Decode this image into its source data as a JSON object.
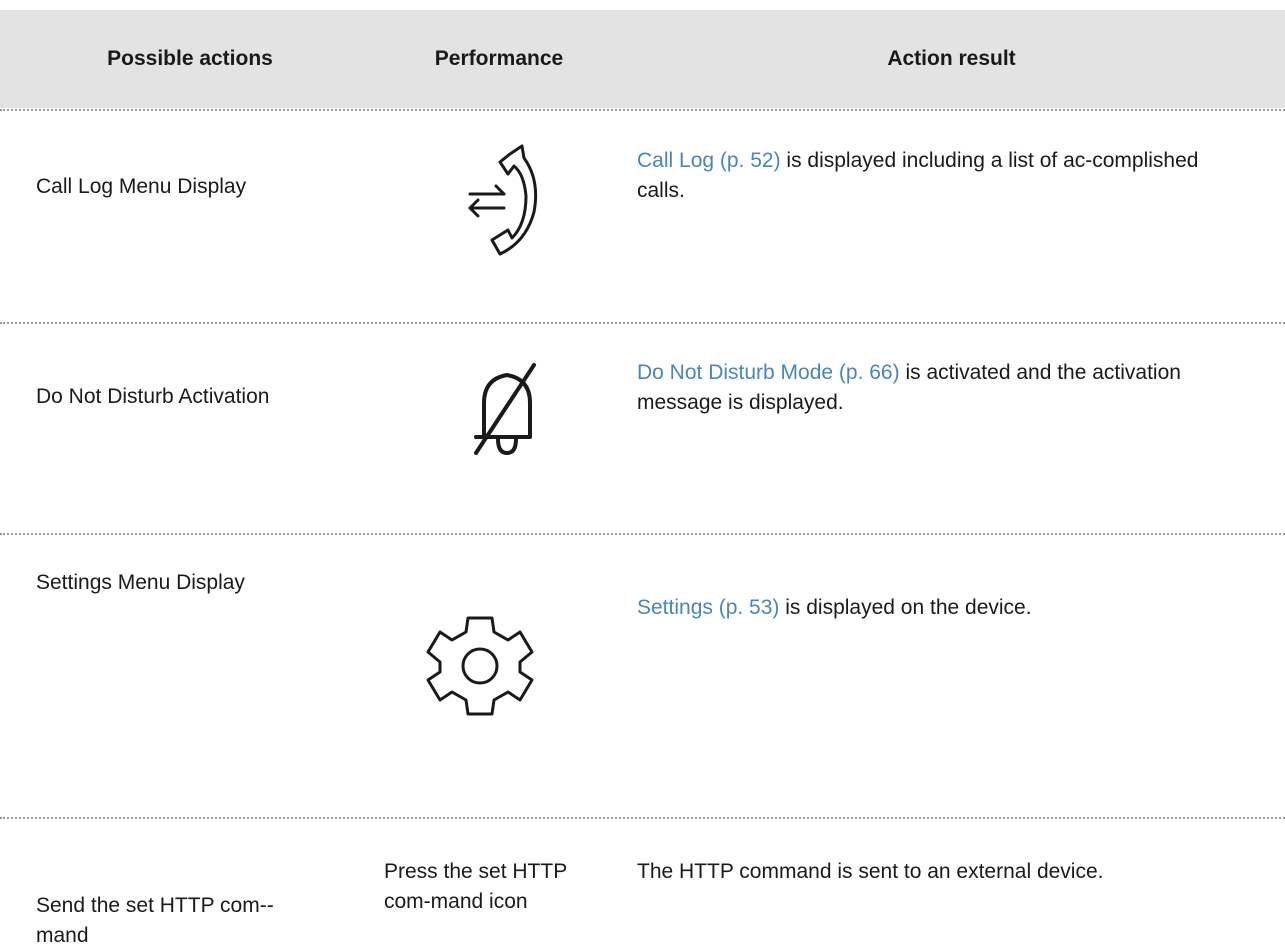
{
  "table": {
    "headers": {
      "actions": "Possible actions",
      "performance": "Performance",
      "result": "Action result"
    },
    "rows": [
      {
        "action": "Call Log Menu Display",
        "performance_icon": "call-log-icon",
        "result_link": "Call Log (p. 52)",
        "result_text": " is displayed including a list of ac-­complished calls."
      },
      {
        "action": "Do Not Disturb Activation",
        "performance_icon": "bell-off-icon",
        "result_link": "Do Not Disturb Mode (p. 66)",
        "result_text": " is activated and the activation message is displayed."
      },
      {
        "action": "Settings Menu Display",
        "performance_icon": "gear-icon",
        "result_link": "Settings (p. 53)",
        "result_text": " is displayed on the device."
      },
      {
        "action": "Send the set HTTP com-­mand",
        "performance": "Press the set HTTP com-­mand icon",
        "result_text": "The HTTP command is sent to an external device."
      }
    ]
  },
  "colors": {
    "header_bg": "#e3e3e3",
    "link": "#4a86b8",
    "text": "#1a1a1a",
    "divider": "#9a9a9a"
  }
}
